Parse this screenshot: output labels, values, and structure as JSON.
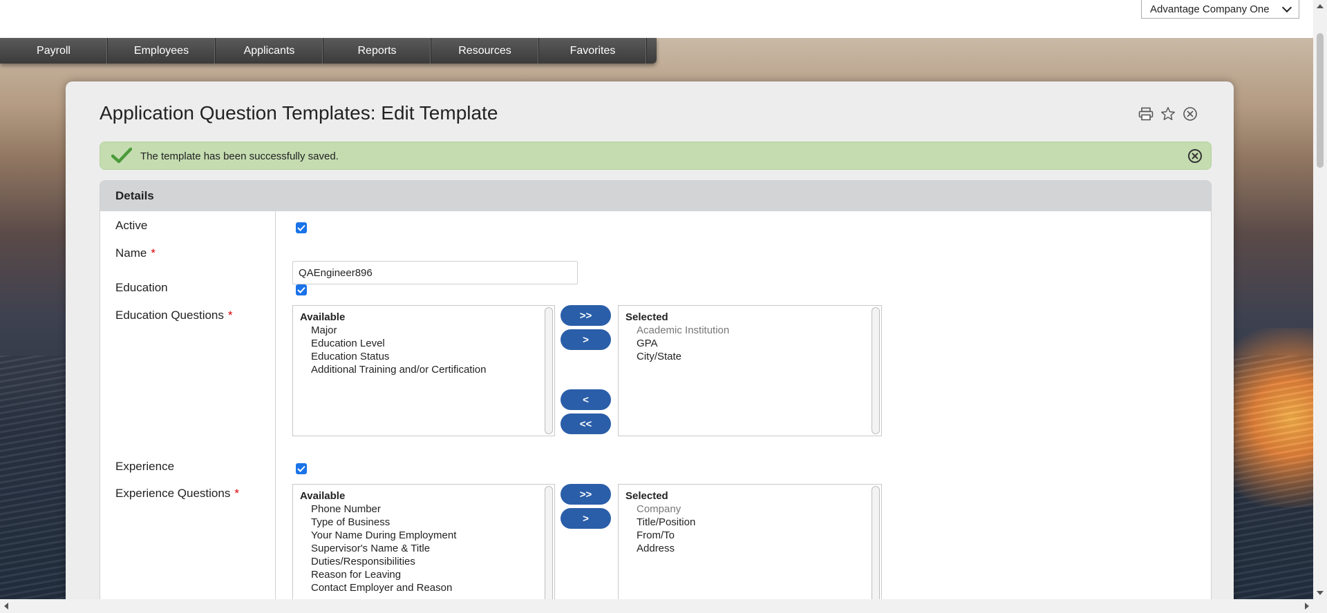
{
  "company_selector": {
    "value": "Advantage Company One"
  },
  "nav": {
    "items": [
      "Payroll",
      "Employees",
      "Applicants",
      "Reports",
      "Resources",
      "Favorites"
    ]
  },
  "page": {
    "title": "Application Question Templates: Edit Template",
    "tools": [
      "print-icon",
      "star-icon",
      "close-circle-icon"
    ]
  },
  "alert": {
    "message": "The template has been successfully saved.",
    "color": "#c4dcb0"
  },
  "details": {
    "heading": "Details",
    "active_label": "Active",
    "active_checked": true,
    "name_label": "Name",
    "name_value": "QAEngineer896",
    "required_marker": "*",
    "education_label": "Education",
    "education_checked": true,
    "education_questions_label": "Education Questions",
    "experience_label": "Experience",
    "experience_checked": true,
    "experience_questions_label": "Experience Questions"
  },
  "education_questions": {
    "available_header": "Available",
    "available": [
      "Major",
      "Education Level",
      "Education Status",
      "Additional Training and/or Certification"
    ],
    "selected_header": "Selected",
    "selected": [
      "Academic Institution",
      "GPA",
      "City/State"
    ],
    "buttons": {
      "add_all": ">>",
      "add": ">",
      "remove": "<",
      "remove_all": "<<"
    }
  },
  "experience_questions": {
    "available_header": "Available",
    "available": [
      "Phone Number",
      "Type of Business",
      "Your Name During Employment",
      "Supervisor's Name & Title",
      "Duties/Responsibilities",
      "Reason for Leaving",
      "Contact Employer and Reason"
    ],
    "selected_header": "Selected",
    "selected": [
      "Company",
      "Title/Position",
      "From/To",
      "Address"
    ],
    "buttons": {
      "add_all": ">>",
      "add": ">"
    }
  },
  "colors": {
    "accent_button": "#2a5ea8",
    "checkbox": "#1a73e8",
    "required": "#dd0000"
  }
}
